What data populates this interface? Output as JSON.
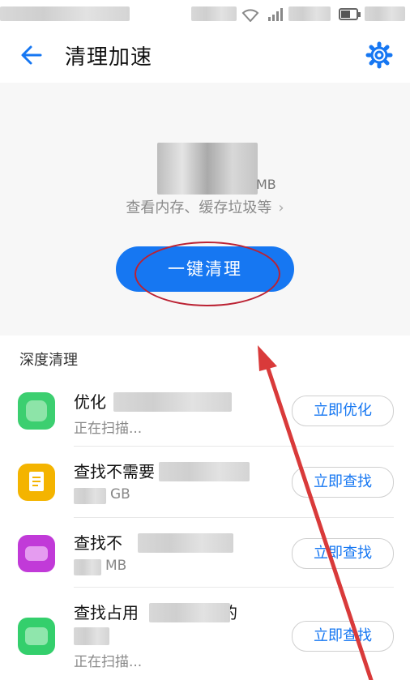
{
  "header": {
    "title": "清理加速"
  },
  "hero": {
    "unit": "MB",
    "subtitle": "查看内存、缓存垃圾等",
    "clean_button": "一键清理"
  },
  "section": {
    "title": "深度清理"
  },
  "items": [
    {
      "title": "优化",
      "subtitle": "正在扫描...",
      "action": "立即优化",
      "icon_color": "#3ccf70"
    },
    {
      "title": "查找不需要",
      "subtitle": "GB",
      "action": "立即查找",
      "icon_color": "#f4b400"
    },
    {
      "title": "查找不",
      "subtitle": "MB",
      "action": "立即查找",
      "icon_color": "#c13ad8"
    },
    {
      "title": "查找占用",
      "title_suffix": "的",
      "subtitle": "正在扫描...",
      "action": "立即查找",
      "icon_color": "#34cf6c"
    }
  ],
  "colors": {
    "accent": "#1677f2",
    "annotation_red": "#d93a3a"
  }
}
